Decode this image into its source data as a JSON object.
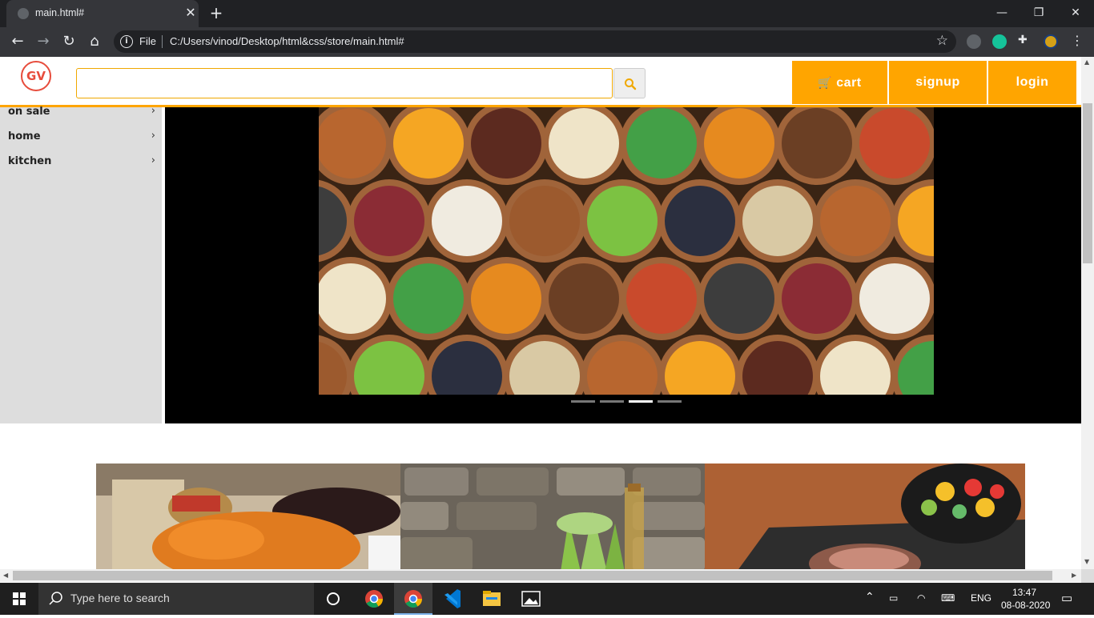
{
  "browser": {
    "tab_title": "main.html#",
    "address_scheme_label": "File",
    "address_url": "C:/Users/vinod/Desktop/html&css/store/main.html#"
  },
  "header": {
    "logo_text": "GV",
    "search_placeholder": "",
    "buttons": {
      "cart": "cart",
      "signup": "signup",
      "login": "login"
    }
  },
  "sidebar": {
    "items": [
      {
        "label": "on sale"
      },
      {
        "label": "home"
      },
      {
        "label": "kitchen"
      }
    ]
  },
  "carousel": {
    "image": "dried fruits and nuts in wooden bowls",
    "slide_count": 4,
    "active_index": 2
  },
  "tiles": [
    {
      "image": "dried fruit market stall"
    },
    {
      "image": "celery and oil bottle on stone wall"
    },
    {
      "image": "salad bowl and grilled meat on board"
    }
  ],
  "taskbar": {
    "search_placeholder": "Type here to search",
    "language": "ENG",
    "time": "13:47",
    "date": "08-08-2020"
  },
  "colors": {
    "accent": "#ffa500",
    "logo": "#e74c3c"
  }
}
